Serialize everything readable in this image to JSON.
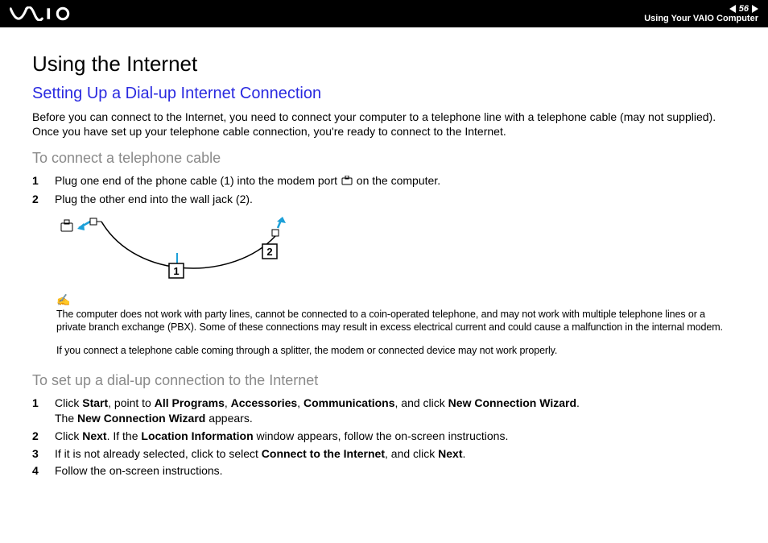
{
  "header": {
    "page_number": "56",
    "chapter": "Using Your VAIO Computer"
  },
  "content": {
    "h1": "Using the Internet",
    "h2": "Setting Up a Dial-up Internet Connection",
    "intro": "Before you can connect to the Internet, you need to connect your computer to a telephone line with a telephone cable (may not supplied). Once you have set up your telephone cable connection, you're ready to connect to the Internet.",
    "section1": {
      "heading": "To connect a telephone cable",
      "step1_a": "Plug one end of the phone cable (1) into the modem port ",
      "step1_b": " on the computer.",
      "step2": "Plug the other end into the wall jack (2)."
    },
    "diagram": {
      "label1": "1",
      "label2": "2"
    },
    "note": {
      "p1": "The computer does not work with party lines, cannot be connected to a coin-operated telephone, and may not work with multiple telephone lines or a private branch exchange (PBX). Some of these connections may result in excess electrical current and could cause a malfunction in the internal modem.",
      "p2": "If you connect a telephone cable coming through a splitter, the modem or connected device may not work properly."
    },
    "section2": {
      "heading": "To set up a dial-up connection to the Internet",
      "step1": {
        "a": "Click ",
        "b": "Start",
        "c": ", point to ",
        "d": "All Programs",
        "e": ", ",
        "f": "Accessories",
        "g": ", ",
        "h": "Communications",
        "i": ", and click ",
        "j": "New Connection Wizard",
        "k": ".",
        "line2a": "The ",
        "line2b": "New Connection Wizard",
        "line2c": " appears."
      },
      "step2": {
        "a": "Click ",
        "b": "Next",
        "c": ". If the ",
        "d": "Location Information",
        "e": " window appears, follow the on-screen instructions."
      },
      "step3": {
        "a": "If it is not already selected, click to select ",
        "b": "Connect to the Internet",
        "c": ", and click ",
        "d": "Next",
        "e": "."
      },
      "step4": "Follow the on-screen instructions."
    }
  }
}
